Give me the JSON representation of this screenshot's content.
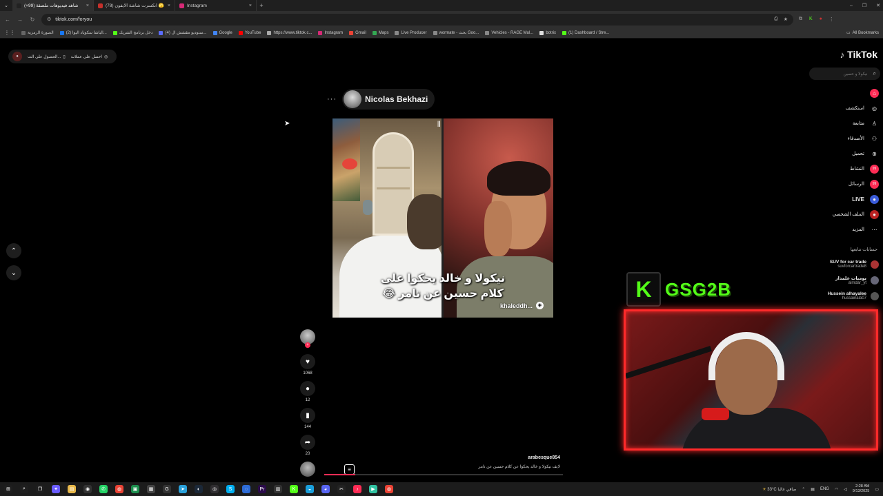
{
  "browser": {
    "tabs": [
      {
        "title": "شاهد فيديوهات ملصقة (99+)",
        "color": "#222",
        "active": true
      },
      {
        "title": "(78) انكسرت شاشة الايفون 🫣",
        "color": "#c4302b",
        "active": false
      },
      {
        "title": "Instagram",
        "color": "#d62976",
        "active": false
      }
    ],
    "url": "tiktok.com/foryou",
    "bookmarks": [
      {
        "label": "الصورة الرمزية",
        "color": "#666"
      },
      {
        "label": "(2) الباشا سكوياد اليوا...",
        "color": "#1877f2"
      },
      {
        "label": "دخل برنامج الشريك",
        "color": "#53fc18"
      },
      {
        "label": "(4) ستوديو مقشش ال...",
        "color": "#5b6cff"
      },
      {
        "label": "Google",
        "color": "#4285f4"
      },
      {
        "label": "YouTube",
        "color": "#ff0000"
      },
      {
        "label": "https://www.tiktok.c...",
        "color": "#aaa"
      },
      {
        "label": "Instagram",
        "color": "#d62976"
      },
      {
        "label": "Gmail",
        "color": "#ea4335"
      },
      {
        "label": "Maps",
        "color": "#34a853"
      },
      {
        "label": "Live Producer",
        "color": "#888"
      },
      {
        "label": "wormate - بحث Goo...",
        "color": "#888"
      },
      {
        "label": "Vehicles - RAGE Mul...",
        "color": "#888"
      },
      {
        "label": "botrix",
        "color": "#ddd"
      },
      {
        "label": "(1) Dashboard / Stre...",
        "color": "#53fc18"
      }
    ],
    "all_bookmarks": "All Bookmarks"
  },
  "page": {
    "top_pill": {
      "get_offers": "احصل على عملات",
      "get_app": "الحصول على الت..."
    },
    "creator_name": "Nicolas Bekhazi",
    "video": {
      "caption_line1": "نيكولا و خالد يحكوا على",
      "caption_line2": "كلام حسين عن تامر 😂",
      "handle": "khaleddh..."
    },
    "actions": {
      "likes": "1068",
      "comments": "12",
      "saves": "144",
      "shares": "20"
    },
    "description": {
      "user": "arabesque854",
      "text": "لايف نيكولا و خالد يحكوا عن كلام حسين عن تامر"
    },
    "progress_fraction": 0.13
  },
  "tiktok": {
    "logo": "TikTok",
    "search_placeholder": "نيكولا و حسين",
    "nav": [
      {
        "label": "",
        "icon": "home-icon",
        "color": "#fe2c55",
        "glyph": "⌂"
      },
      {
        "label": "استكشف",
        "icon": "compass-icon",
        "color": "#000",
        "glyph": "◎"
      },
      {
        "label": "متابعة",
        "icon": "user-icon",
        "color": "#000",
        "glyph": "♙"
      },
      {
        "label": "الأصدقاء",
        "icon": "friends-icon",
        "color": "#000",
        "glyph": "⚇"
      },
      {
        "label": "تحميل",
        "icon": "upload-icon",
        "color": "#000",
        "glyph": "⊕"
      },
      {
        "label": "النشاط",
        "icon": "activity-icon",
        "color": "#fe2c55",
        "glyph": "99"
      },
      {
        "label": "الرسائل",
        "icon": "messages-icon",
        "color": "#fe2c55",
        "glyph": "99"
      },
      {
        "label": "LIVE",
        "icon": "live-icon",
        "color": "#3a5bd9",
        "glyph": "●"
      },
      {
        "label": "الملف الشخصي",
        "icon": "profile-icon",
        "color": "#b22",
        "glyph": "●"
      },
      {
        "label": "المزيد",
        "icon": "more-icon",
        "color": "#000",
        "glyph": "⋯"
      }
    ],
    "following_title": "حسابات تتابعها",
    "following": [
      {
        "name": "SUV for car trade",
        "handle": "suvforcartrade8",
        "color": "#a33"
      },
      {
        "name": "يوميات علمدار",
        "handle": "almdar_yt",
        "color": "#667"
      },
      {
        "name": "Hussein alhayalee",
        "handle": "hussainala07",
        "color": "#555"
      }
    ]
  },
  "overlay": {
    "k_letter": "K",
    "channel": "GSG2B"
  },
  "taskbar": {
    "weather": "33°C صافي غالبا",
    "lang": "ENG",
    "time": "2:28 AM",
    "date": "9/13/2025",
    "icons": [
      {
        "name": "windows-icon",
        "color": "#1f1f1f",
        "glyph": "⊞"
      },
      {
        "name": "search-icon",
        "color": "#1f1f1f",
        "glyph": "⌕"
      },
      {
        "name": "task-view-icon",
        "color": "#1f1f1f",
        "glyph": "❐"
      },
      {
        "name": "copilot-icon",
        "color": "#6a5cff",
        "glyph": "✦"
      },
      {
        "name": "file-explorer-icon",
        "color": "#e8b84a",
        "glyph": "▤"
      },
      {
        "name": "davinci-icon",
        "color": "#333",
        "glyph": "◉"
      },
      {
        "name": "whatsapp-icon",
        "color": "#25d366",
        "glyph": "✆"
      },
      {
        "name": "chrome-icon",
        "color": "#ea4335",
        "glyph": "◍"
      },
      {
        "name": "app-green-icon",
        "color": "#1d8f4e",
        "glyph": "▣"
      },
      {
        "name": "calculator-icon",
        "color": "#444",
        "glyph": "▦"
      },
      {
        "name": "app-g-icon",
        "color": "#333",
        "glyph": "G"
      },
      {
        "name": "telegram-icon",
        "color": "#2aa1da",
        "glyph": "➤"
      },
      {
        "name": "steam-icon",
        "color": "#1b2838",
        "glyph": "◐"
      },
      {
        "name": "obs-icon",
        "color": "#302e31",
        "glyph": "◎"
      },
      {
        "name": "skype-icon",
        "color": "#00aff0",
        "glyph": "S"
      },
      {
        "name": "app-blue-icon",
        "color": "#2d6bd6",
        "glyph": "◌"
      },
      {
        "name": "premiere-icon",
        "color": "#2a0a4a",
        "glyph": "Pr"
      },
      {
        "name": "app-dark-icon",
        "color": "#333",
        "glyph": "▥"
      },
      {
        "name": "kick-icon",
        "color": "#53fc18",
        "glyph": "K"
      },
      {
        "name": "edge-icon",
        "color": "#1a9fdb",
        "glyph": "◒"
      },
      {
        "name": "discord-icon",
        "color": "#5865f2",
        "glyph": "◕"
      },
      {
        "name": "capcut-icon",
        "color": "#222",
        "glyph": "✂"
      },
      {
        "name": "tiktok-icon",
        "color": "#fe2c55",
        "glyph": "♪"
      },
      {
        "name": "streamlabs-icon",
        "color": "#31c3a2",
        "glyph": "▶"
      },
      {
        "name": "chrome-active-icon",
        "color": "#ea4335",
        "glyph": "◍"
      }
    ]
  }
}
